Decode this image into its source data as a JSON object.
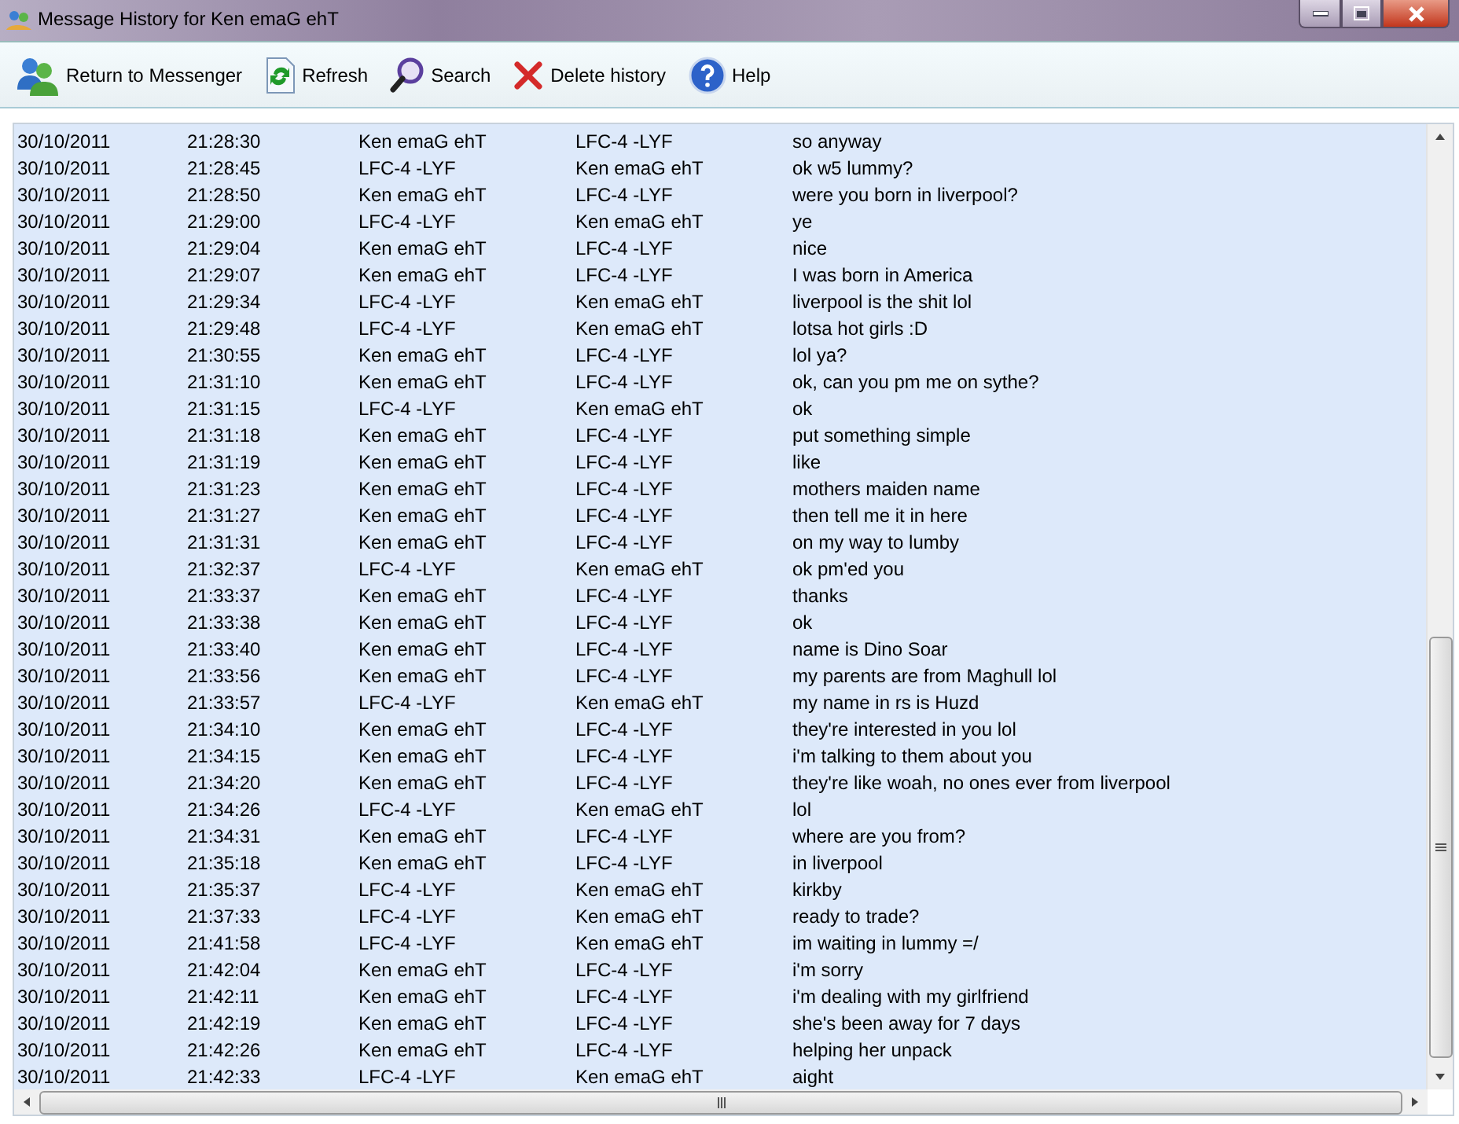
{
  "window": {
    "title": "Message History for Ken emaG ehT"
  },
  "toolbar": [
    {
      "kind": "people",
      "label": "Return to Messenger"
    },
    {
      "kind": "refresh",
      "label": "Refresh"
    },
    {
      "kind": "search",
      "label": "Search"
    },
    {
      "kind": "delete",
      "label": "Delete history"
    },
    {
      "kind": "help",
      "label": "Help"
    }
  ],
  "messages": [
    [
      "30/10/2011",
      "21:28:30",
      "Ken emaG ehT",
      "LFC-4 -LYF",
      "so anyway"
    ],
    [
      "30/10/2011",
      "21:28:45",
      "LFC-4 -LYF",
      "Ken emaG ehT",
      "ok w5 lummy?"
    ],
    [
      "30/10/2011",
      "21:28:50",
      "Ken emaG ehT",
      "LFC-4 -LYF",
      "were you born in liverpool?"
    ],
    [
      "30/10/2011",
      "21:29:00",
      "LFC-4 -LYF",
      "Ken emaG ehT",
      "ye"
    ],
    [
      "30/10/2011",
      "21:29:04",
      "Ken emaG ehT",
      "LFC-4 -LYF",
      "nice"
    ],
    [
      "30/10/2011",
      "21:29:07",
      "Ken emaG ehT",
      "LFC-4 -LYF",
      "I was born in America"
    ],
    [
      "30/10/2011",
      "21:29:34",
      "LFC-4 -LYF",
      "Ken emaG ehT",
      "liverpool is the shit lol"
    ],
    [
      "30/10/2011",
      "21:29:48",
      "LFC-4 -LYF",
      "Ken emaG ehT",
      "lotsa hot girls :D"
    ],
    [
      "30/10/2011",
      "21:30:55",
      "Ken emaG ehT",
      "LFC-4 -LYF",
      "lol ya?"
    ],
    [
      "30/10/2011",
      "21:31:10",
      "Ken emaG ehT",
      "LFC-4 -LYF",
      "ok, can you pm me on sythe?"
    ],
    [
      "30/10/2011",
      "21:31:15",
      "LFC-4 -LYF",
      "Ken emaG ehT",
      "ok"
    ],
    [
      "30/10/2011",
      "21:31:18",
      "Ken emaG ehT",
      "LFC-4 -LYF",
      "put something simple"
    ],
    [
      "30/10/2011",
      "21:31:19",
      "Ken emaG ehT",
      "LFC-4 -LYF",
      "like"
    ],
    [
      "30/10/2011",
      "21:31:23",
      "Ken emaG ehT",
      "LFC-4 -LYF",
      "mothers maiden name"
    ],
    [
      "30/10/2011",
      "21:31:27",
      "Ken emaG ehT",
      "LFC-4 -LYF",
      "then tell me it in here"
    ],
    [
      "30/10/2011",
      "21:31:31",
      "Ken emaG ehT",
      "LFC-4 -LYF",
      "on my way to lumby"
    ],
    [
      "30/10/2011",
      "21:32:37",
      "LFC-4 -LYF",
      "Ken emaG ehT",
      "ok pm'ed you"
    ],
    [
      "30/10/2011",
      "21:33:37",
      "Ken emaG ehT",
      "LFC-4 -LYF",
      "thanks"
    ],
    [
      "30/10/2011",
      "21:33:38",
      "Ken emaG ehT",
      "LFC-4 -LYF",
      "ok"
    ],
    [
      "30/10/2011",
      "21:33:40",
      "Ken emaG ehT",
      "LFC-4 -LYF",
      "name is Dino Soar"
    ],
    [
      "30/10/2011",
      "21:33:56",
      "Ken emaG ehT",
      "LFC-4 -LYF",
      "my parents are from Maghull lol"
    ],
    [
      "30/10/2011",
      "21:33:57",
      "LFC-4 -LYF",
      "Ken emaG ehT",
      "my name in rs is Huzd"
    ],
    [
      "30/10/2011",
      "21:34:10",
      "Ken emaG ehT",
      "LFC-4 -LYF",
      "they're interested in you lol"
    ],
    [
      "30/10/2011",
      "21:34:15",
      "Ken emaG ehT",
      "LFC-4 -LYF",
      "i'm talking to them about you"
    ],
    [
      "30/10/2011",
      "21:34:20",
      "Ken emaG ehT",
      "LFC-4 -LYF",
      "they're like woah, no ones ever from liverpool"
    ],
    [
      "30/10/2011",
      "21:34:26",
      "LFC-4 -LYF",
      "Ken emaG ehT",
      "lol"
    ],
    [
      "30/10/2011",
      "21:34:31",
      "Ken emaG ehT",
      "LFC-4 -LYF",
      "where are you from?"
    ],
    [
      "30/10/2011",
      "21:35:18",
      "Ken emaG ehT",
      "LFC-4 -LYF",
      "in liverpool"
    ],
    [
      "30/10/2011",
      "21:35:37",
      "LFC-4 -LYF",
      "Ken emaG ehT",
      "kirkby"
    ],
    [
      "30/10/2011",
      "21:37:33",
      "LFC-4 -LYF",
      "Ken emaG ehT",
      "ready to trade?"
    ],
    [
      "30/10/2011",
      "21:41:58",
      "LFC-4 -LYF",
      "Ken emaG ehT",
      "im waiting in lummy =/"
    ],
    [
      "30/10/2011",
      "21:42:04",
      "Ken emaG ehT",
      "LFC-4 -LYF",
      "i'm sorry"
    ],
    [
      "30/10/2011",
      "21:42:11",
      "Ken emaG ehT",
      "LFC-4 -LYF",
      "i'm dealing with my girlfriend"
    ],
    [
      "30/10/2011",
      "21:42:19",
      "Ken emaG ehT",
      "LFC-4 -LYF",
      "she's been away for 7 days"
    ],
    [
      "30/10/2011",
      "21:42:26",
      "Ken emaG ehT",
      "LFC-4 -LYF",
      "helping her unpack"
    ],
    [
      "30/10/2011",
      "21:42:33",
      "LFC-4 -LYF",
      "Ken emaG ehT",
      "aight"
    ]
  ]
}
